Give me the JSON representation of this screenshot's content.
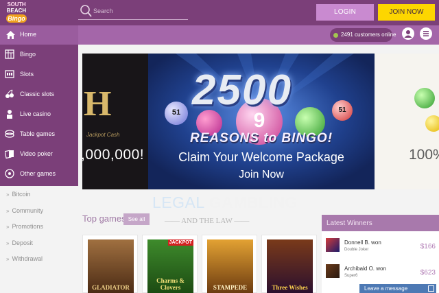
{
  "header": {
    "logo": {
      "line1": "SOUTH",
      "line2": "BEACH",
      "line3": "Bingo"
    },
    "search_placeholder": "Search",
    "login_label": "LOGIN",
    "join_label": "JOIN NOW"
  },
  "homebar": {
    "home_label": "Home",
    "customers_online": "2491 customers online"
  },
  "sidebar": {
    "items": [
      {
        "label": "Bingo",
        "icon": "bingo-card-icon"
      },
      {
        "label": "Slots",
        "icon": "slot-machine-icon"
      },
      {
        "label": "Classic slots",
        "icon": "cherries-icon"
      },
      {
        "label": "Live casino",
        "icon": "dealer-icon"
      },
      {
        "label": "Table games",
        "icon": "chips-icon"
      },
      {
        "label": "Video poker",
        "icon": "cards-icon"
      },
      {
        "label": "Other games",
        "icon": "dice-icon"
      }
    ],
    "sub_items": [
      "Bitcoin",
      "Community",
      "Promotions",
      "Deposit",
      "Withdrawal"
    ]
  },
  "banner": {
    "left_jackpot": "Jackpot Cash",
    "left_amount": ",000,000!",
    "headline": "2500",
    "subhead": "REASONS to BINGO!",
    "claim": "Claim Your Welcome Package",
    "cta": "Join Now",
    "right_amount": "100%",
    "balls": [
      "51",
      "9",
      "51"
    ]
  },
  "watermark": {
    "title": "LEGAL GAMBLING",
    "subtitle": "AND THE LAW"
  },
  "top_games": {
    "title": "Top games",
    "see_all": "See all",
    "games": [
      {
        "name": "GLADIATOR",
        "tag": ""
      },
      {
        "name": "Charms & Clovers",
        "tag": "JACKPOT"
      },
      {
        "name": "STAMPEDE",
        "tag": ""
      },
      {
        "name": "Three Wishes",
        "tag": ""
      }
    ]
  },
  "winners": {
    "title": "Latest Winners",
    "rows": [
      {
        "name": "Donnell B. won",
        "game": "Double Joker",
        "amount": "$166"
      },
      {
        "name": "Archibald O. won",
        "game": "Super6",
        "amount": "$623"
      }
    ]
  },
  "chat": {
    "label": "Leave a message"
  },
  "colors": {
    "primary": "#7b3f79",
    "accent": "#fdd600",
    "secondary": "#a466a9"
  }
}
